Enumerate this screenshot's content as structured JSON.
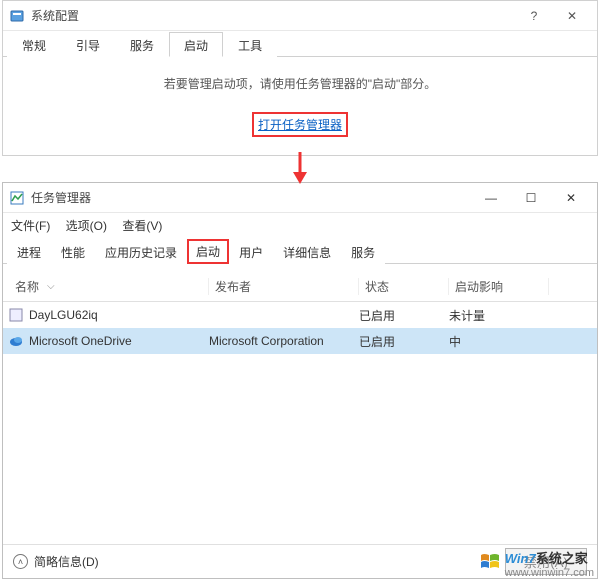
{
  "sysconfig": {
    "title": "系统配置",
    "tabs": [
      "常规",
      "引导",
      "服务",
      "启动",
      "工具"
    ],
    "active_tab_index": 3,
    "message": "若要管理启动项，请使用任务管理器的\"启动\"部分。",
    "link": "打开任务管理器"
  },
  "task_manager": {
    "title": "任务管理器",
    "menus": [
      "文件(F)",
      "选项(O)",
      "查看(V)"
    ],
    "tabs": [
      "进程",
      "性能",
      "应用历史记录",
      "启动",
      "用户",
      "详细信息",
      "服务"
    ],
    "active_tab_index": 3,
    "columns": {
      "name": "名称",
      "publisher": "发布者",
      "status": "状态",
      "impact": "启动影响"
    },
    "rows": [
      {
        "icon": "generic-app-icon",
        "name": "DayLGU62iq",
        "publisher": "",
        "status": "已启用",
        "impact": "未计量",
        "selected": false
      },
      {
        "icon": "onedrive-icon",
        "name": "Microsoft OneDrive",
        "publisher": "Microsoft Corporation",
        "status": "已启用",
        "impact": "中",
        "selected": true
      }
    ],
    "footer": {
      "collapse_label": "简略信息(D)",
      "button": "禁用(A)"
    }
  },
  "watermark": {
    "brand_left": "Win7",
    "brand_right": "系统之家",
    "url": "www.winwin7.com"
  }
}
